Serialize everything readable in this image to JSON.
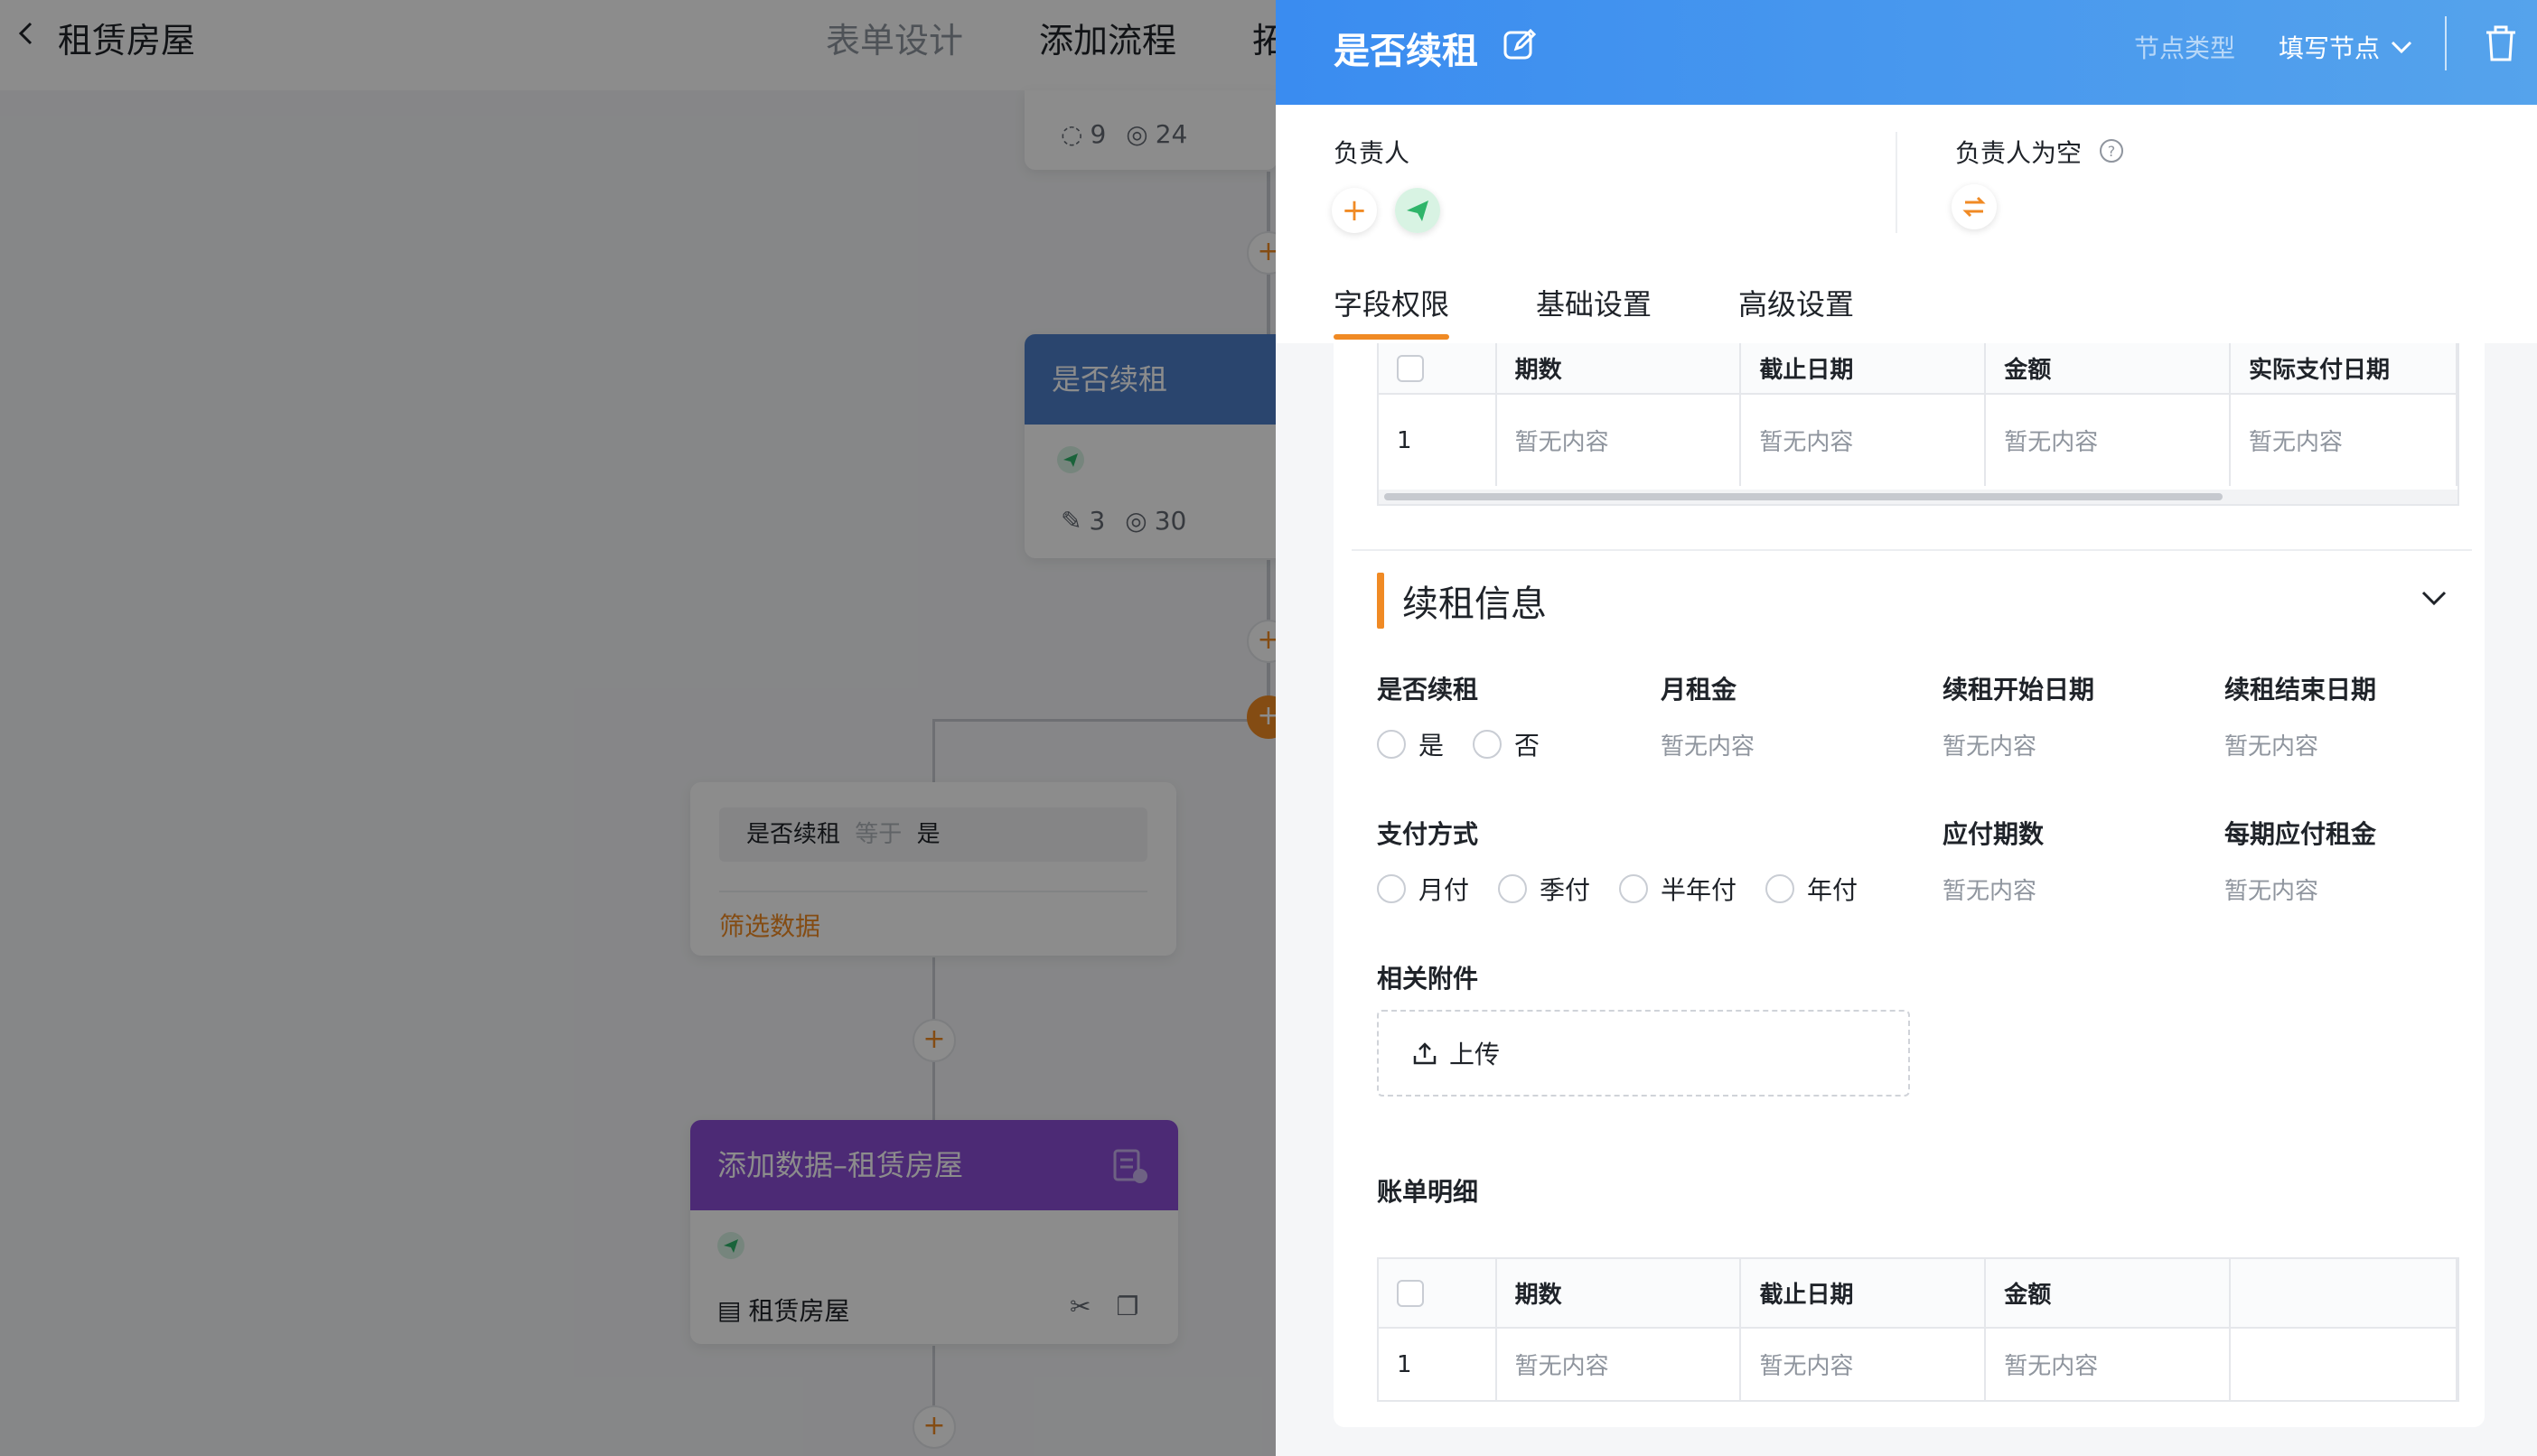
{
  "canvas": {
    "app_title": "租赁房屋",
    "top_tabs": [
      "表单设计",
      "添加流程",
      "拓"
    ],
    "node1_stats": {
      "a": "9",
      "b": "24"
    },
    "node2": {
      "title": "是否续租",
      "stats_a": "3",
      "stats_b": "30"
    },
    "filter_card": {
      "field": "是否续租",
      "op": "等于",
      "value": "是",
      "link": "筛选数据"
    },
    "node3": {
      "title": "添加数据–租赁房屋",
      "form_name": "租赁房屋"
    },
    "plus": "+"
  },
  "drawer": {
    "title": "是否续租",
    "node_type_label": "节点类型",
    "node_type_value": "填写节点",
    "owner_label": "负责人",
    "owner_empty_label": "负责人为空",
    "owner_add": "+",
    "tabs": [
      "字段权限",
      "基础设置",
      "高级设置"
    ],
    "table1": {
      "headers": [
        "期数",
        "截止日期",
        "金额",
        "实际支付日期"
      ],
      "rows": [
        [
          "1",
          "暂无内容",
          "暂无内容",
          "暂无内容",
          "暂无内容"
        ]
      ]
    },
    "section_title": "续租信息",
    "fields": {
      "renew": {
        "label": "是否续租",
        "options": [
          "是",
          "否"
        ]
      },
      "monthly_rent": {
        "label": "月租金",
        "value": "暂无内容"
      },
      "renew_start": {
        "label": "续租开始日期",
        "value": "暂无内容"
      },
      "renew_end": {
        "label": "续租结束日期",
        "value": "暂无内容"
      },
      "payment": {
        "label": "支付方式",
        "options": [
          "月付",
          "季付",
          "半年付",
          "年付"
        ]
      },
      "periods": {
        "label": "应付期数",
        "value": "暂无内容"
      },
      "rent_per_period": {
        "label": "每期应付租金",
        "value": "暂无内容"
      },
      "attachment": {
        "label": "相关附件",
        "upload": "上传"
      }
    },
    "bill_detail_label": "账单明细",
    "table2": {
      "headers": [
        "期数",
        "截止日期",
        "金额",
        ""
      ],
      "rows": [
        [
          "1",
          "暂无内容",
          "暂无内容",
          "暂无内容",
          ""
        ]
      ]
    },
    "colors": {
      "accent": "#f08a24",
      "header_blue": "#3a8cf0",
      "purple": "#8a4dd6"
    }
  }
}
